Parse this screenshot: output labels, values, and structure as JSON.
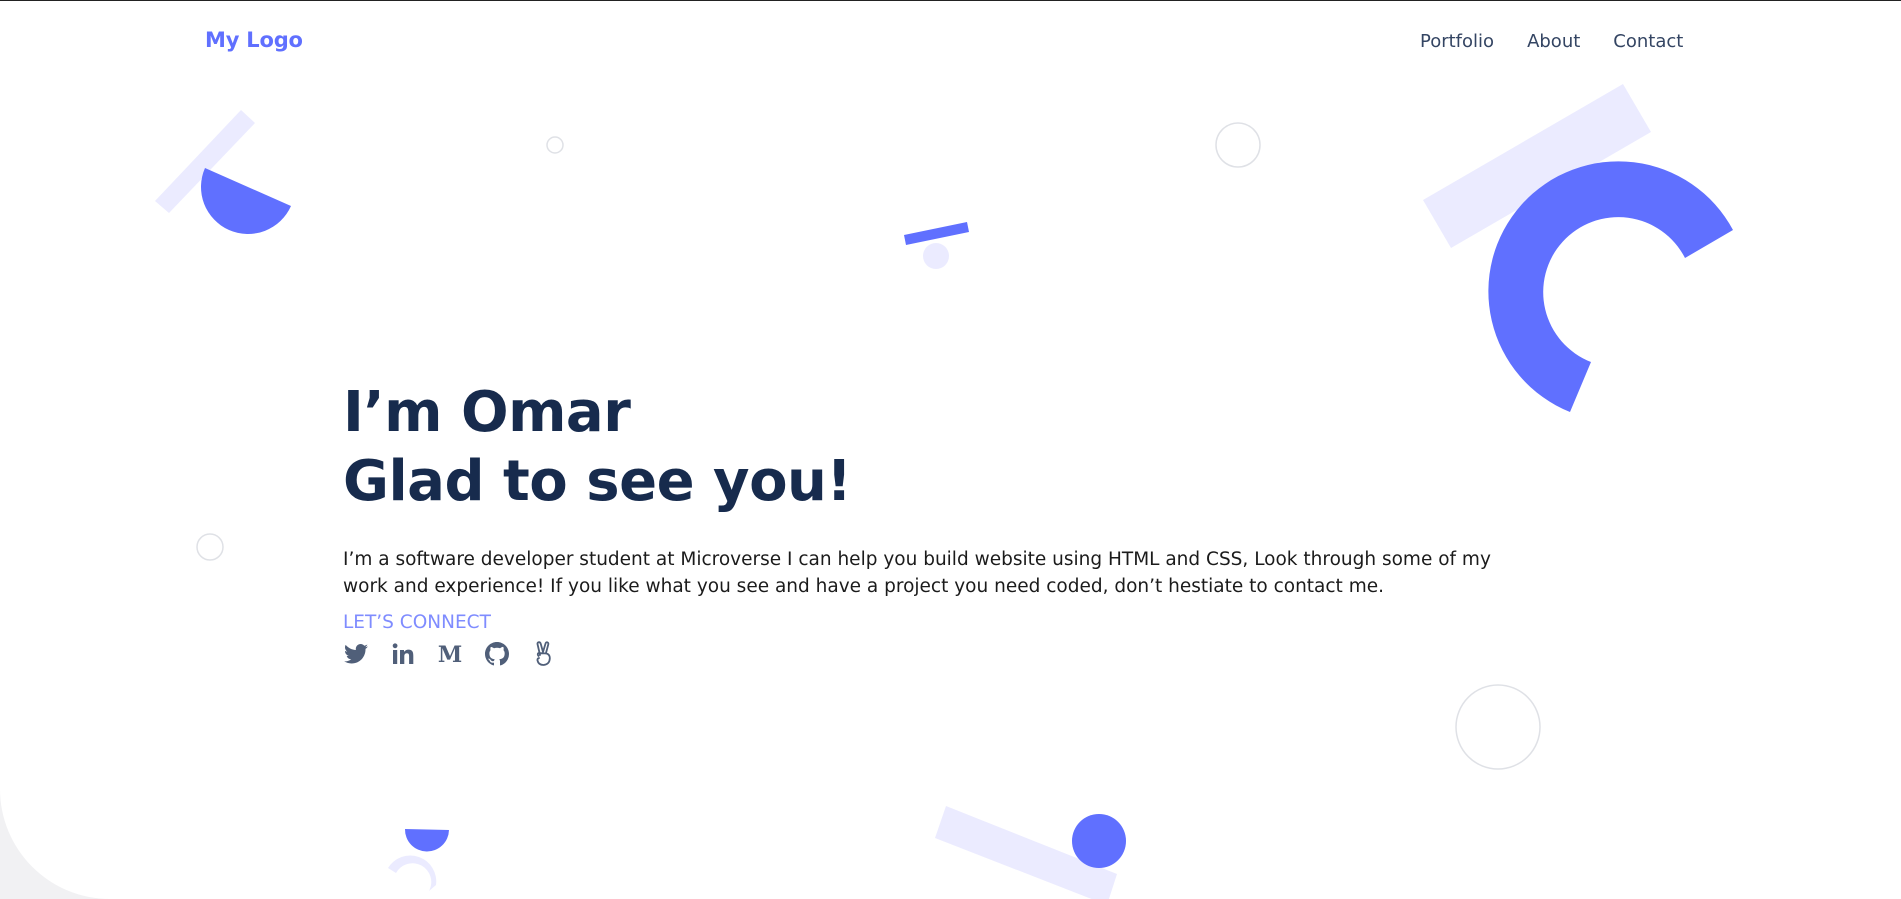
{
  "header": {
    "logo": "My Logo",
    "nav": [
      {
        "label": "Portfolio"
      },
      {
        "label": "About"
      },
      {
        "label": "Contact"
      }
    ]
  },
  "hero": {
    "title_line1": "I’m Omar",
    "title_line2": "Glad to see you!",
    "intro": "I’m a software developer student at Microverse I can help you build website using HTML and CSS, Look through some of my work and experience! If you like what you see and have a project you need coded, don’t hestiate to contact me.",
    "connect_label": "LET’S CONNECT",
    "socials": [
      {
        "icon": "twitter-icon"
      },
      {
        "icon": "linkedin-icon"
      },
      {
        "icon": "medium-icon"
      },
      {
        "icon": "github-icon"
      },
      {
        "icon": "angellist-icon"
      }
    ]
  },
  "colors": {
    "accent": "#6070ff",
    "accent_light": "#ebebff",
    "heading": "#172b4d",
    "nav_text": "#344563",
    "connect": "#7f8cff",
    "icon": "#505f79",
    "outline_circle": "#dfe1e6"
  }
}
